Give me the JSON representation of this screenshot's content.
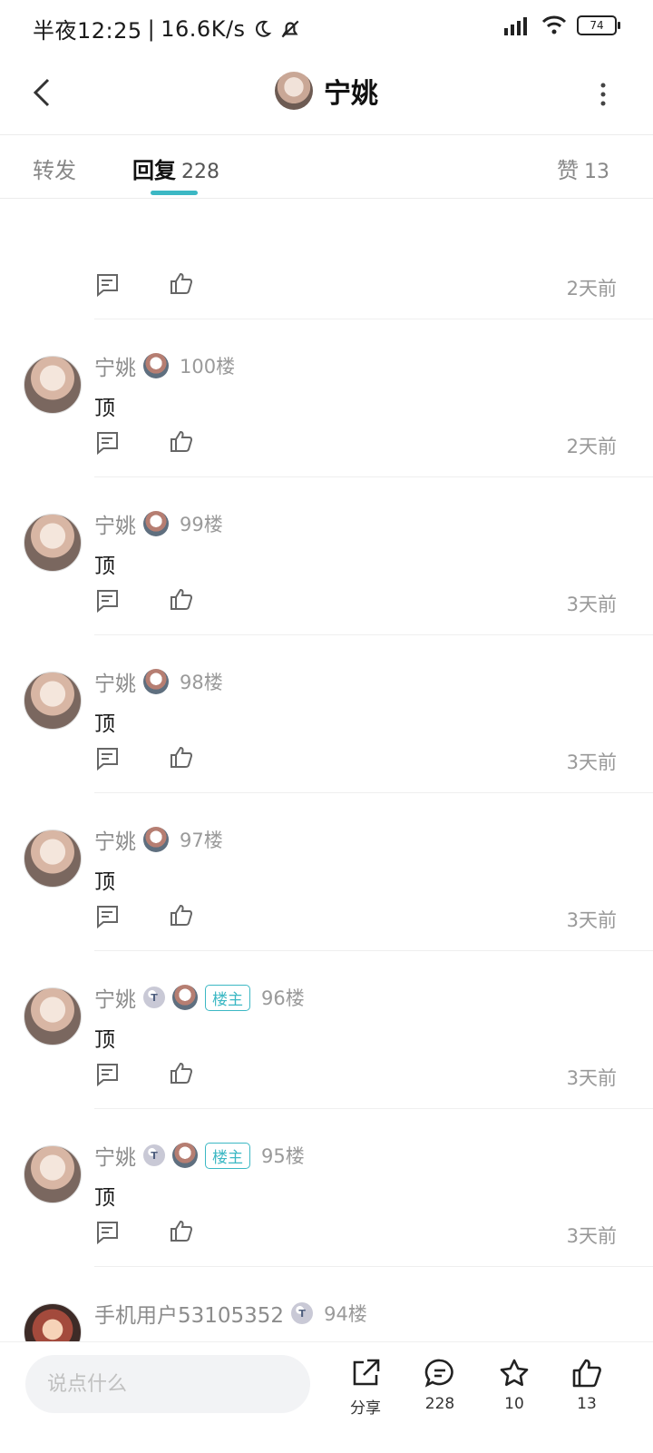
{
  "status_bar": {
    "time": "半夜12:25",
    "network_speed": "16.6K/s",
    "battery": "74"
  },
  "header": {
    "title": "宁姚"
  },
  "tabs": {
    "repost_label": "转发",
    "reply_label": "回复",
    "reply_count": "228",
    "like_label": "赞",
    "like_count": "13"
  },
  "replies": [
    {
      "time": "2天前"
    },
    {
      "name": "宁姚",
      "floor": "100楼",
      "content": "顶",
      "time": "2天前"
    },
    {
      "name": "宁姚",
      "floor": "99楼",
      "content": "顶",
      "time": "3天前"
    },
    {
      "name": "宁姚",
      "floor": "98楼",
      "content": "顶",
      "time": "3天前"
    },
    {
      "name": "宁姚",
      "floor": "97楼",
      "content": "顶",
      "time": "3天前"
    },
    {
      "name": "宁姚",
      "floor": "96楼",
      "badge": "楼主",
      "content": "顶",
      "time": "3天前"
    },
    {
      "name": "宁姚",
      "floor": "95楼",
      "badge": "楼主",
      "content": "顶",
      "time": "3天前"
    },
    {
      "name": "手机用户53105352",
      "floor": "94楼"
    }
  ],
  "bottom_bar": {
    "input_placeholder": "说点什么",
    "share_label": "分享",
    "reply_count": "228",
    "favorite_count": "10",
    "like_count": "13"
  },
  "colors": {
    "accent": "#3cb8c4",
    "muted_text": "#999999"
  },
  "icons": [
    "back-icon",
    "more-icon",
    "comment-icon",
    "thumbs-up-icon",
    "share-icon",
    "chat-bubble-icon",
    "star-icon"
  ]
}
